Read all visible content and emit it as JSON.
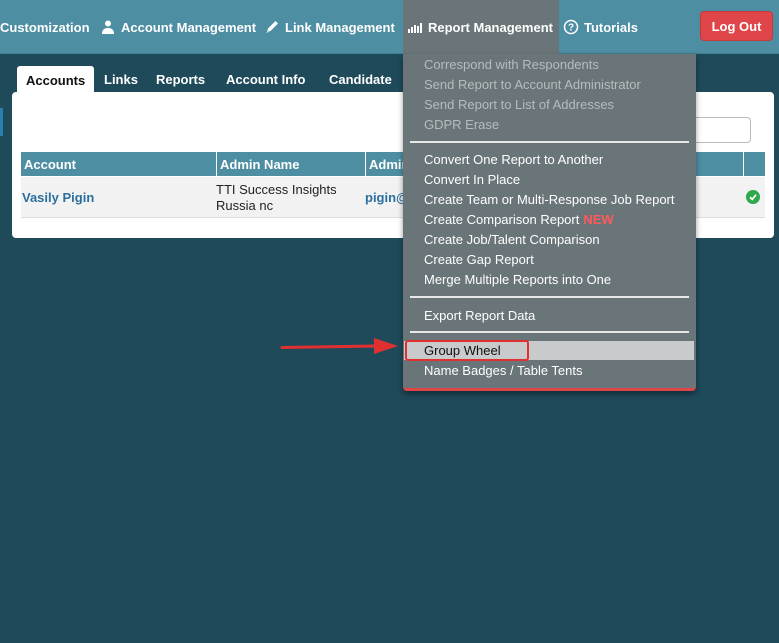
{
  "nav": {
    "items": [
      {
        "label": "Customization",
        "icon": "none"
      },
      {
        "label": "Account Management",
        "icon": "users-icon"
      },
      {
        "label": "Link Management",
        "icon": "pencil-icon"
      },
      {
        "label": "Report Management",
        "icon": "bar-chart-icon"
      },
      {
        "label": "Tutorials",
        "icon": "help-circle-icon"
      }
    ],
    "logout_label": "Log Out"
  },
  "tabs": [
    "Accounts",
    "Links",
    "Reports",
    "Account Info",
    "Candidate"
  ],
  "table": {
    "headers": [
      "Account",
      "Admin Name",
      "Admin"
    ],
    "row": {
      "account": "Vasily Pigin",
      "admin_name_line1": "TTI Success Insights",
      "admin_name_line2": "Russia nc",
      "admin_email_partial": "pigin@"
    }
  },
  "dropdown": {
    "group1": [
      "Correspond with Respondents",
      "Send Report to Account Administrator",
      "Send Report to List of Addresses",
      "GDPR Erase"
    ],
    "group2": [
      "Convert One Report to Another",
      "Convert In Place",
      "Create Team or Multi-Response Job Report",
      "Create Comparison Report",
      "Create Job/Talent Comparison",
      "Create Gap Report",
      "Merge Multiple Reports into One"
    ],
    "new_badge": "NEW",
    "group3": [
      "Export Report Data"
    ],
    "group4": [
      "Group Wheel",
      "Name Badges / Table Tents"
    ]
  },
  "colors": {
    "background": "#1e4a5a",
    "nav": "#4d8ea3",
    "menu": "#6a7579",
    "accent_red": "#e0454a",
    "link": "#2c6f9e"
  }
}
